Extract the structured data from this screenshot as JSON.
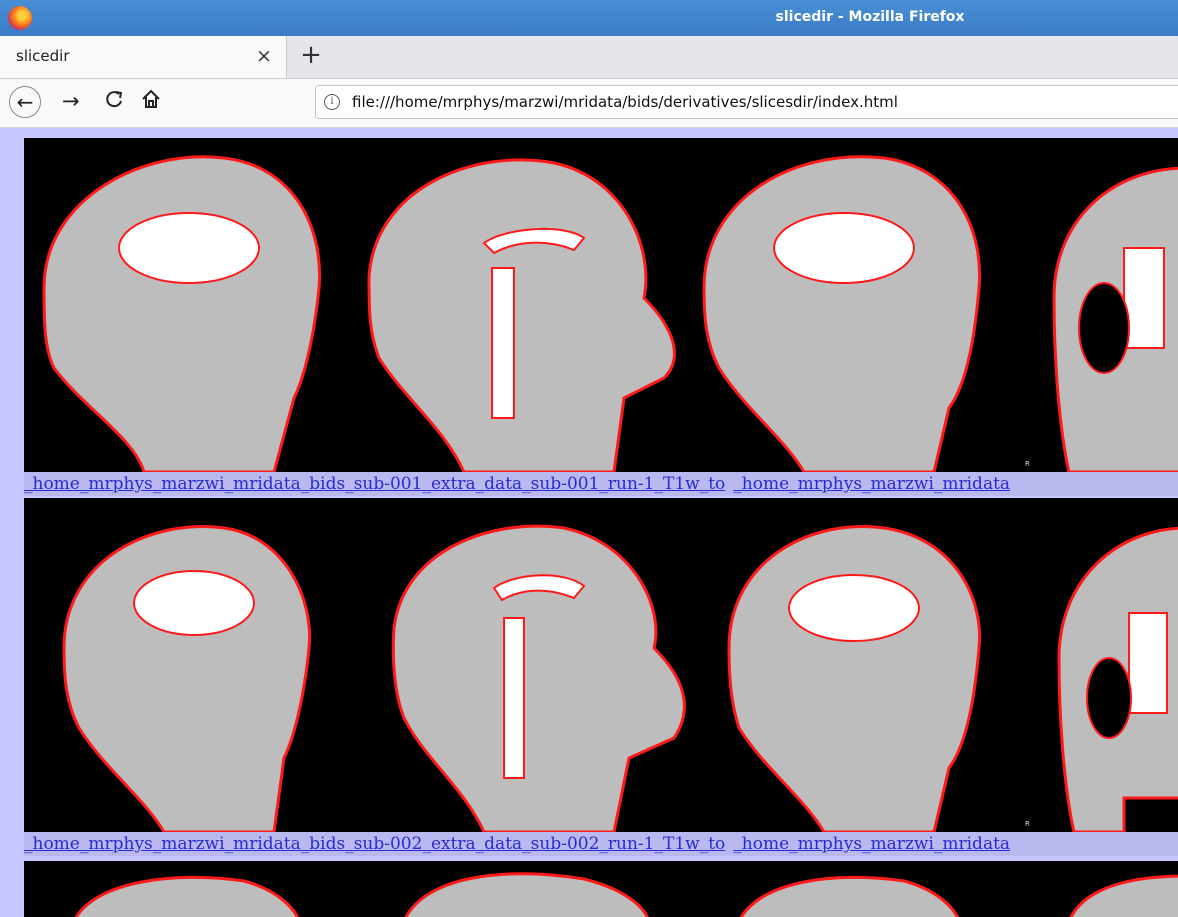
{
  "window": {
    "title": "slicedir - Mozilla Firefox"
  },
  "tabs": [
    {
      "label": "slicedir",
      "close_glyph": "×"
    }
  ],
  "newtab_glyph": "+",
  "nav": {
    "back_glyph": "←",
    "forward_glyph": "→",
    "reload_glyph": "C",
    "home_glyph": "⌂",
    "info_glyph": "i"
  },
  "url": "file:///home/mrphys/marzwi/mridata/bids/derivatives/slicesdir/index.html",
  "rows": [
    {
      "link1": "_home_mrphys_marzwi_mridata_bids_sub-001_extra_data_sub-001_run-1_T1w_to",
      "link2": "_home_mrphys_marzwi_mridata",
      "marker": "R"
    },
    {
      "link1": "_home_mrphys_marzwi_mridata_bids_sub-002_extra_data_sub-002_run-1_T1w_to",
      "link2": "_home_mrphys_marzwi_mridata",
      "marker": "R"
    }
  ],
  "colors": {
    "overlay": "#ff1a1a",
    "background": "#c7c7ff",
    "link": "#2a2ad0"
  },
  "icons": [
    "firefox-logo",
    "close-icon",
    "plus-icon",
    "back-arrow-icon",
    "forward-arrow-icon",
    "reload-icon",
    "home-icon",
    "info-icon"
  ]
}
